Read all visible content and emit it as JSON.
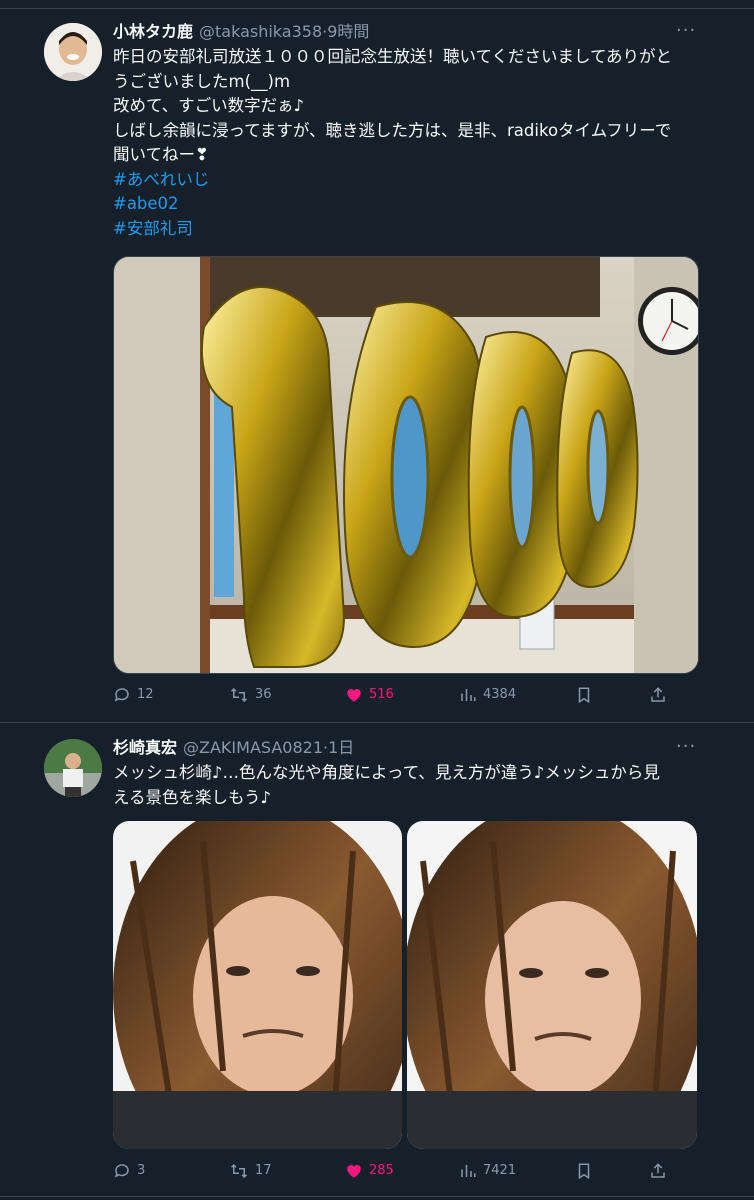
{
  "tweets": [
    {
      "display_name": "小林タカ鹿",
      "handle": "@takashika358",
      "time": "9時間",
      "text_lines": [
        "昨日の安部礼司放送１０００回記念生放送！聴いてくださいましてありがと",
        "うございましたm(__)m",
        "改めて、すごい数字だぁ♪",
        "しばし余韻に浸ってますが、聴き逃した方は、是非、radikoタイムフリーで",
        "聞いてねー❣"
      ],
      "hashtags": [
        "#あべれいじ",
        "#abe02",
        "#安部礼司"
      ],
      "replies": "12",
      "retweets": "36",
      "likes": "516",
      "views": "4384"
    },
    {
      "display_name": "杉崎真宏",
      "handle": "@ZAKIMASA0821",
      "time": "1日",
      "text_lines": [
        "メッシュ杉崎♪…色んな光や角度によって、見え方が違う♪メッシュから見",
        "える景色を楽しもう♪"
      ],
      "hashtags": [],
      "replies": "3",
      "retweets": "17",
      "likes": "285",
      "views": "7421"
    }
  ],
  "icons": {
    "reply": "reply-icon",
    "retweet": "retweet-icon",
    "like": "heart-icon",
    "views": "views-icon",
    "bookmark": "bookmark-icon",
    "share": "share-icon",
    "more": "more-icon"
  },
  "colors": {
    "background": "#15202b",
    "link": "#1d9bf0",
    "like_active": "#f91880",
    "secondary_text": "#8b98a5"
  }
}
